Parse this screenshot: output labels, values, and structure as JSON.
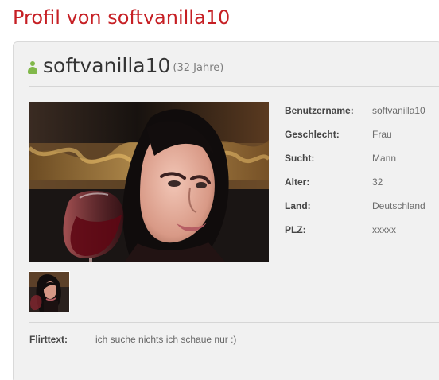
{
  "page": {
    "title": "Profil von softvanilla10"
  },
  "profile": {
    "username": "softvanilla10",
    "age_suffix": "(32 Jahre)",
    "icon": "person-icon",
    "accent_color": "#81b84a",
    "details": [
      {
        "label": "Benutzername:",
        "value": "softvanilla10"
      },
      {
        "label": "Geschlecht:",
        "value": "Frau"
      },
      {
        "label": "Sucht:",
        "value": "Mann"
      },
      {
        "label": "Alter:",
        "value": "32"
      },
      {
        "label": "Land:",
        "value": "Deutschland"
      },
      {
        "label": "PLZ:",
        "value": "xxxxx"
      }
    ],
    "flirt": {
      "label": "Flirttext:",
      "text": "ich suche nichts ich schaue nur :)"
    }
  },
  "colors": {
    "title": "#c61f24",
    "card_background": "#f1f1f1",
    "text": "#464646"
  }
}
